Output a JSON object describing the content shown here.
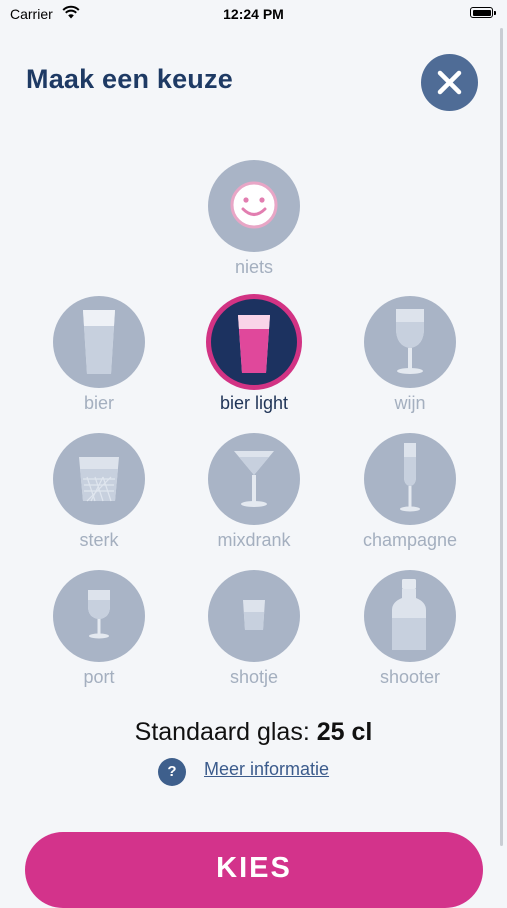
{
  "status_bar": {
    "carrier": "Carrier",
    "time": "12:24 PM"
  },
  "header": {
    "title": "Maak een keuze",
    "close_icon": "close-icon"
  },
  "options": [
    {
      "id": "niets",
      "label": "niets",
      "icon": "smiley-icon",
      "selected": false
    },
    {
      "id": "bier",
      "label": "bier",
      "icon": "beer-glass-icon",
      "selected": false
    },
    {
      "id": "bier-light",
      "label": "bier light",
      "icon": "beer-light-glass-icon",
      "selected": true
    },
    {
      "id": "wijn",
      "label": "wijn",
      "icon": "wine-glass-icon",
      "selected": false
    },
    {
      "id": "sterk",
      "label": "sterk",
      "icon": "tumbler-glass-icon",
      "selected": false
    },
    {
      "id": "mixdrank",
      "label": "mixdrank",
      "icon": "cocktail-glass-icon",
      "selected": false
    },
    {
      "id": "champagne",
      "label": "champagne",
      "icon": "champagne-flute-icon",
      "selected": false
    },
    {
      "id": "port",
      "label": "port",
      "icon": "port-glass-icon",
      "selected": false
    },
    {
      "id": "shotje",
      "label": "shotje",
      "icon": "shot-glass-icon",
      "selected": false
    },
    {
      "id": "shooter",
      "label": "shooter",
      "icon": "bottle-icon",
      "selected": false
    }
  ],
  "standard_glass": {
    "label": "Standaard glas:",
    "value": "25 cl"
  },
  "info": {
    "icon_text": "?",
    "link": "Meer informatie"
  },
  "primary_button": {
    "label": "KIES"
  },
  "colors": {
    "background": "#f4f6f9",
    "navy": "#1e3a64",
    "accent_pink": "#d3338b",
    "option_gray": "#a9b4c6",
    "label_gray": "#a4afbf"
  }
}
